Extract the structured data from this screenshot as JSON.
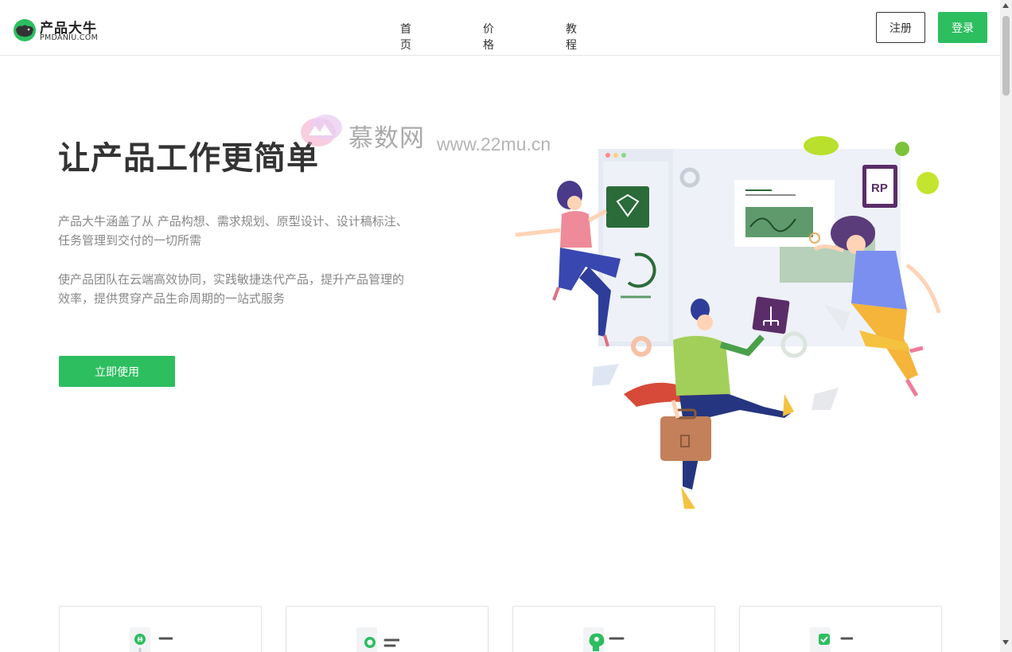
{
  "header": {
    "logo": {
      "name": "产品大牛",
      "domain": "PMDANIU.COM"
    },
    "nav": [
      {
        "label": "首页"
      },
      {
        "label": "价格"
      },
      {
        "label": "教程"
      }
    ],
    "register_label": "注册",
    "login_label": "登录"
  },
  "hero": {
    "title": "让产品工作更简单",
    "desc1": "产品大牛涵盖了从 产品构想、需求规划、原型设计、设计稿标注、任务管理到交付的一切所需",
    "desc2": "使产品团队在云端高效协同，实践敏捷迭代产品，提升产品管理的效率，提供贯穿产品生命周期的一站式服务",
    "cta_label": "立即使用"
  },
  "watermark": {
    "text": "慕数网",
    "url": "www.22mu.cn"
  },
  "illustration": {
    "badge_text": "RP"
  },
  "features": [
    {
      "icon": "link-icon"
    },
    {
      "icon": "target-icon"
    },
    {
      "icon": "brain-icon"
    },
    {
      "icon": "check-icon"
    }
  ],
  "colors": {
    "brand_green": "#2dbe60",
    "text_dark": "#333333",
    "text_muted": "#888888"
  }
}
